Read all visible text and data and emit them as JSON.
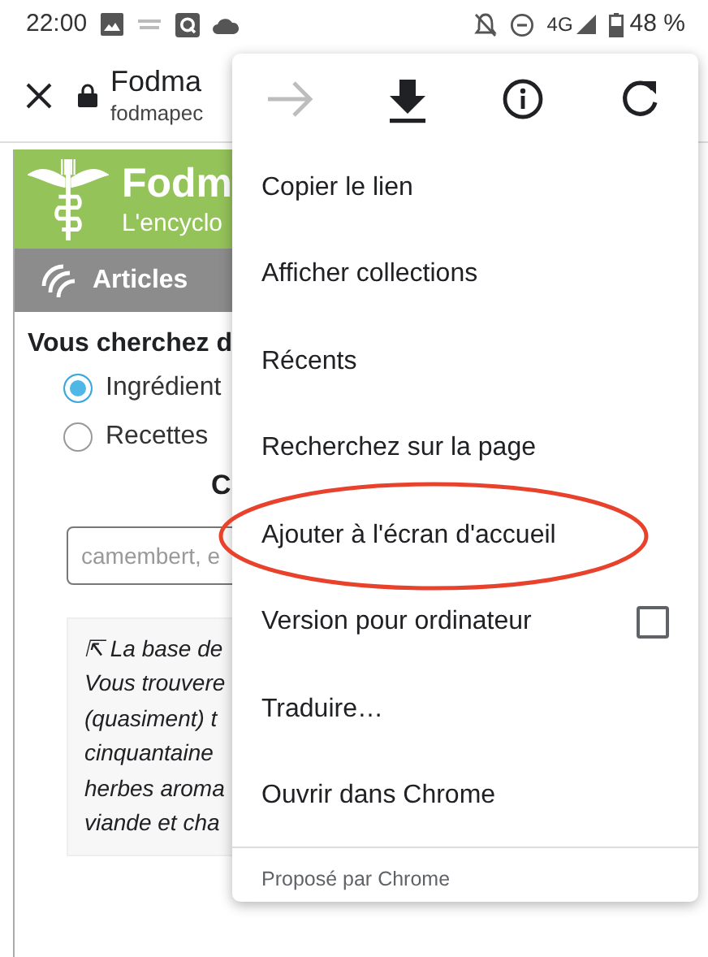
{
  "status_bar": {
    "time": "22:00",
    "network": "4G",
    "battery": "48 %"
  },
  "toolbar": {
    "title": "Fodma",
    "url": "fodmapec"
  },
  "page": {
    "site_title": "Fodm",
    "tagline": "L'encyclo",
    "nav_item": "Articles",
    "question": "Vous cherchez d",
    "options": [
      {
        "label": "Ingrédient",
        "selected": true
      },
      {
        "label": "Recettes",
        "selected": false
      }
    ],
    "heading": "C",
    "search": {
      "placeholder": "camembert, e"
    },
    "info_lines": [
      "⇱ La base de",
      "Vous trouvere",
      "(quasiment) t",
      "cinquantaine",
      "herbes aroma",
      "viande et cha"
    ]
  },
  "menu": {
    "actions": [
      {
        "kind": "forward",
        "disabled": true
      },
      {
        "kind": "download",
        "disabled": false
      },
      {
        "kind": "info",
        "disabled": false
      },
      {
        "kind": "reload",
        "disabled": false
      }
    ],
    "items": [
      {
        "label": "Copier le lien",
        "kind": "plain"
      },
      {
        "label": "Afficher collections",
        "kind": "plain"
      },
      {
        "label": "Récents",
        "kind": "plain"
      },
      {
        "label": "Recherchez sur la page",
        "kind": "plain"
      },
      {
        "label": "Ajouter à l'écran d'accueil",
        "kind": "plain",
        "highlighted": true
      },
      {
        "label": "Version pour ordinateur",
        "kind": "checkbox",
        "checked": false
      },
      {
        "label": "Traduire…",
        "kind": "plain"
      },
      {
        "label": "Ouvrir dans Chrome",
        "kind": "plain"
      }
    ],
    "footer": "Proposé par Chrome"
  }
}
